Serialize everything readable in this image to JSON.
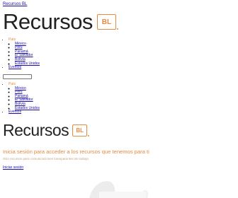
{
  "header": {
    "top_link": "Recursos BL"
  },
  "logo": {
    "word": "Recursos",
    "badge": "BL"
  },
  "menu": {
    "pais": "País",
    "countries": [
      "México",
      "Perú",
      "Panamá",
      "El Salvador",
      "Bolivia",
      "Estados Unidos"
    ],
    "eventos": "Eventos"
  },
  "search": {
    "placeholder": ""
  },
  "main": {
    "headline": "Inicia sesión para acceder a los recursos que tenemos para ti",
    "subline": "Otro recursos para comunicaciones transparentes de trabajo",
    "login_link": "Iniciar sesión"
  },
  "colors": {
    "accent": "#e8893c",
    "link": "#1a0dab"
  }
}
